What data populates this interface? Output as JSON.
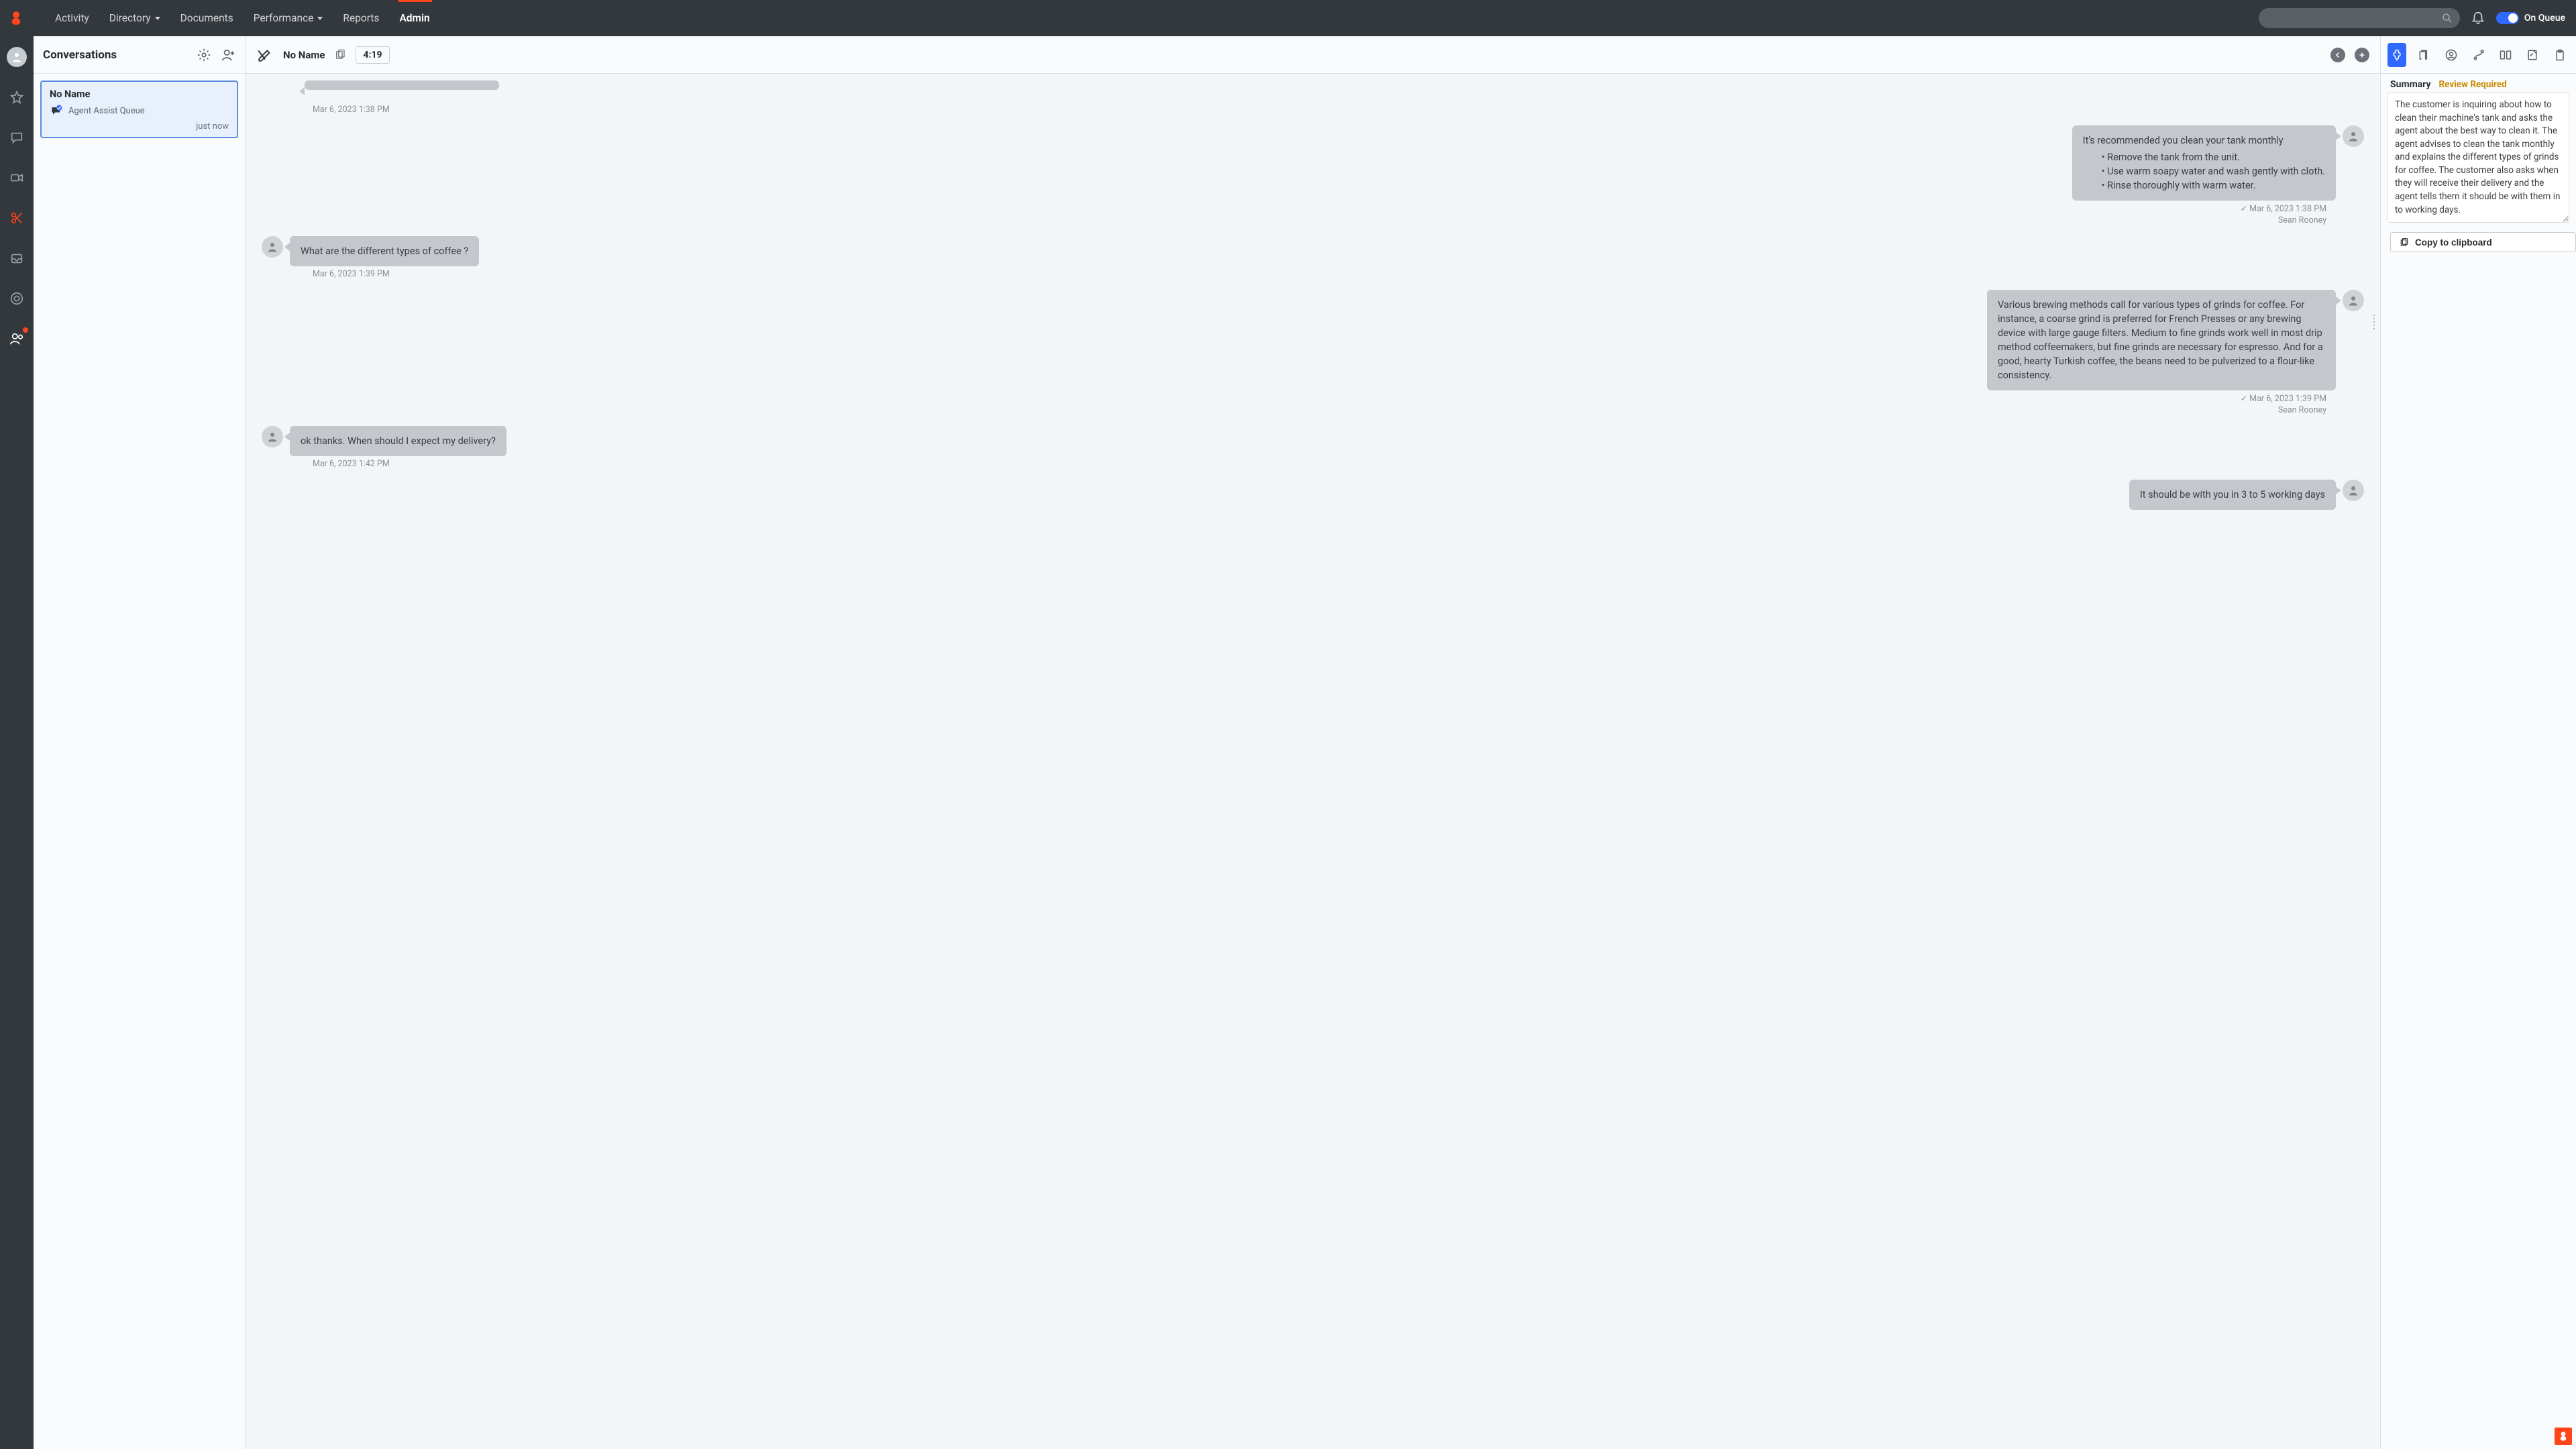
{
  "topnav": {
    "items": [
      {
        "label": "Activity",
        "dropdown": false
      },
      {
        "label": "Directory",
        "dropdown": true
      },
      {
        "label": "Documents",
        "dropdown": false
      },
      {
        "label": "Performance",
        "dropdown": true
      },
      {
        "label": "Reports",
        "dropdown": false
      },
      {
        "label": "Admin",
        "dropdown": false,
        "active": true
      }
    ],
    "queue_label": "On Queue"
  },
  "conversations": {
    "title": "Conversations",
    "card": {
      "name": "No Name",
      "queue": "Agent Assist Queue",
      "time": "just now"
    }
  },
  "main": {
    "contact_name": "No Name",
    "timer": "4:19",
    "messages": [
      {
        "side": "cust",
        "text": "",
        "cutoff": true,
        "meta_time": "Mar 6, 2023 1:38 PM"
      },
      {
        "side": "agent",
        "text": "It's recommended you clean your tank monthly",
        "bullets": [
          "Remove the tank from the unit.",
          "Use warm soapy water and wash gently with cloth.",
          "Rinse thoroughly with warm water."
        ],
        "meta_time": "Mar 6, 2023 1:38 PM",
        "sender": "Sean Rooney"
      },
      {
        "side": "cust",
        "text": "What are the different types of coffee ?",
        "meta_time": "Mar 6, 2023 1:39 PM"
      },
      {
        "side": "agent",
        "text": "Various brewing methods call for various types of grinds for coffee. For instance, a coarse grind is preferred for French Presses or any brewing device with large gauge filters. Medium to fine grinds work well in most drip method coffeemakers, but fine grinds are necessary for espresso. And for a good, hearty Turkish coffee, the beans need to be pulverized to a flour-like consistency.",
        "meta_time": "Mar 6, 2023 1:39 PM",
        "sender": "Sean Rooney"
      },
      {
        "side": "cust",
        "text": "ok thanks. When should I expect my delivery?",
        "meta_time": "Mar 6, 2023 1:42 PM"
      },
      {
        "side": "agent",
        "text": "It should be with you in 3 to 5 working days"
      }
    ]
  },
  "assist": {
    "summary_label": "Summary",
    "review_label": "Review Required",
    "summary_text": "The customer is inquiring about how to clean their machine's tank and asks the agent about the best way to clean it. The agent advises to clean the tank monthly and explains the different types of grinds for coffee. The customer also asks when they will receive their delivery and the agent tells them it should be with them in to working days.",
    "copy_label": "Copy to clipboard"
  }
}
